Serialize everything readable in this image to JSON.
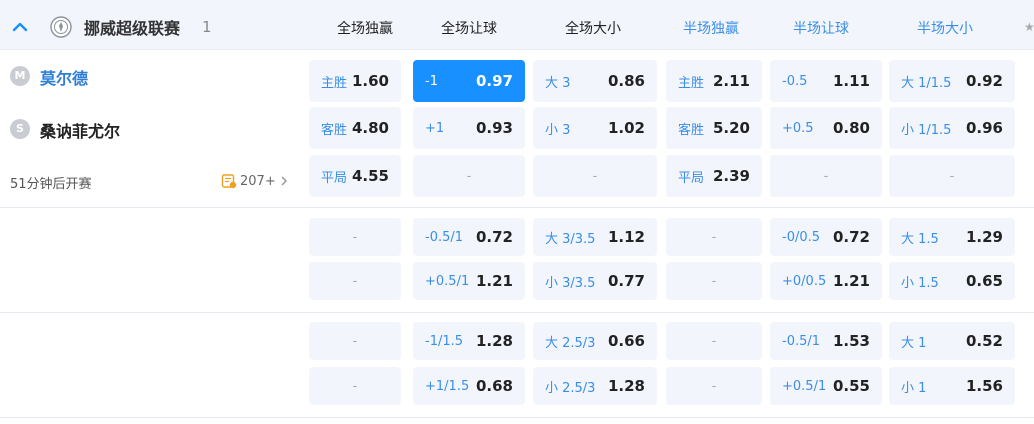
{
  "league": {
    "name": "挪威超级联赛",
    "count": "1",
    "icons": {
      "toggle": "chevron-up-icon",
      "logo": "league-emblem-icon"
    }
  },
  "columns": [
    {
      "label": "全场独赢",
      "group": "full"
    },
    {
      "label": "全场让球",
      "group": "full"
    },
    {
      "label": "全场大小",
      "group": "full"
    },
    {
      "label": "半场独赢",
      "group": "half"
    },
    {
      "label": "半场让球",
      "group": "half"
    },
    {
      "label": "半场大小",
      "group": "half"
    }
  ],
  "match": {
    "home": {
      "badge": "M",
      "name": "莫尔德"
    },
    "away": {
      "badge": "S",
      "name": "桑讷菲尤尔"
    },
    "kickoff": "51分钟后开赛",
    "more_count": "207+"
  },
  "colors": {
    "selected": "#1890ff",
    "accent": "#3a8ee6",
    "cell_bg": "#f2f6fc"
  },
  "odds_rows": [
    [
      {
        "l": "主胜",
        "o": "1.60"
      },
      {
        "l": "-1",
        "o": "0.97",
        "selected": true
      },
      {
        "l": "大 3",
        "o": "0.86"
      },
      {
        "l": "主胜",
        "o": "2.11"
      },
      {
        "l": "-0.5",
        "o": "1.11"
      },
      {
        "l": "大 1/1.5",
        "o": "0.92"
      }
    ],
    [
      {
        "l": "客胜",
        "o": "4.80"
      },
      {
        "l": "+1",
        "o": "0.93"
      },
      {
        "l": "小 3",
        "o": "1.02"
      },
      {
        "l": "客胜",
        "o": "5.20"
      },
      {
        "l": "+0.5",
        "o": "0.80"
      },
      {
        "l": "小 1/1.5",
        "o": "0.96"
      }
    ],
    [
      {
        "l": "平局",
        "o": "4.55"
      },
      {
        "empty": "-"
      },
      {
        "empty": "-"
      },
      {
        "l": "平局",
        "o": "2.39"
      },
      {
        "empty": "-"
      },
      {
        "empty": "-"
      }
    ],
    [
      {
        "empty": "-"
      },
      {
        "l": "-0.5/1",
        "o": "0.72"
      },
      {
        "l": "大 3/3.5",
        "o": "1.12"
      },
      {
        "empty": "-"
      },
      {
        "l": "-0/0.5",
        "o": "0.72"
      },
      {
        "l": "大 1.5",
        "o": "1.29"
      }
    ],
    [
      {
        "empty": "-"
      },
      {
        "l": "+0.5/1",
        "o": "1.21"
      },
      {
        "l": "小 3/3.5",
        "o": "0.77"
      },
      {
        "empty": "-"
      },
      {
        "l": "+0/0.5",
        "o": "1.21"
      },
      {
        "l": "小 1.5",
        "o": "0.65"
      }
    ],
    [
      {
        "empty": "-"
      },
      {
        "l": "-1/1.5",
        "o": "1.28"
      },
      {
        "l": "大 2.5/3",
        "o": "0.66"
      },
      {
        "empty": "-"
      },
      {
        "l": "-0.5/1",
        "o": "1.53"
      },
      {
        "l": "大 1",
        "o": "0.52"
      }
    ],
    [
      {
        "empty": "-"
      },
      {
        "l": "+1/1.5",
        "o": "0.68"
      },
      {
        "l": "小 2.5/3",
        "o": "1.28"
      },
      {
        "empty": "-"
      },
      {
        "l": "+0.5/1",
        "o": "0.55"
      },
      {
        "l": "小 1",
        "o": "1.56"
      }
    ]
  ]
}
